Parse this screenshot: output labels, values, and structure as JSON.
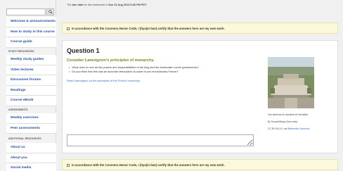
{
  "sidebar": {
    "search": {
      "placeholder": ""
    },
    "main_items": [
      {
        "label": "Welcome & announcements"
      },
      {
        "label": "How to study in this course"
      },
      {
        "label": "Course guide"
      }
    ],
    "study_heading": "STUDY RESOURCES",
    "study_items": [
      {
        "label": "Weekly study guides"
      },
      {
        "label": "Video lectures"
      },
      {
        "label": "Discussion forums"
      },
      {
        "label": "Readings"
      },
      {
        "label": "Course eBook"
      }
    ],
    "assess_heading": "ASSESSMENTS",
    "assess_items": [
      {
        "label": "Weekly exercises"
      },
      {
        "label": "Peer assessments"
      }
    ],
    "additional_heading": "ADDITIONAL RESOURCES",
    "additional_items": [
      {
        "label": "About us"
      },
      {
        "label": "About you"
      },
      {
        "label": "Social media"
      }
    ]
  },
  "due": {
    "prefix": "The",
    "strong1": "due date",
    "middle": "for this homework is",
    "strong2": "Sun 31 Aug 2014 5:36 PM PDT"
  },
  "honor_text": "In accordance with the Coursera Honor Code, I (hyojin bae) certify that the answers here are my own work.",
  "question": {
    "title": "Question 1",
    "subtitle": "Consider Lamoignon's principles of monarchy.",
    "bullets": [
      "What does he see as the powers and responsibilities of the king and the aristocratic courts (parlements)?",
      "Do you think that this was an accurate description of power in pre-revolutionary France?"
    ],
    "link": "Read Lamoignon on the principles of the French monarchy"
  },
  "image_caption": {
    "line1": "Vue aérienne du domaine de Versailles",
    "line2": "By ToucanWings (Own work),",
    "line3_prefix": "CC-BY-SA-3.0, via",
    "line3_link": "Wikimedia Commons."
  },
  "answer": {
    "value": ""
  },
  "colors": {
    "link": "#1f4e9c",
    "accent_green": "#6b8e23",
    "honor_bg": "#fcf8dc"
  }
}
